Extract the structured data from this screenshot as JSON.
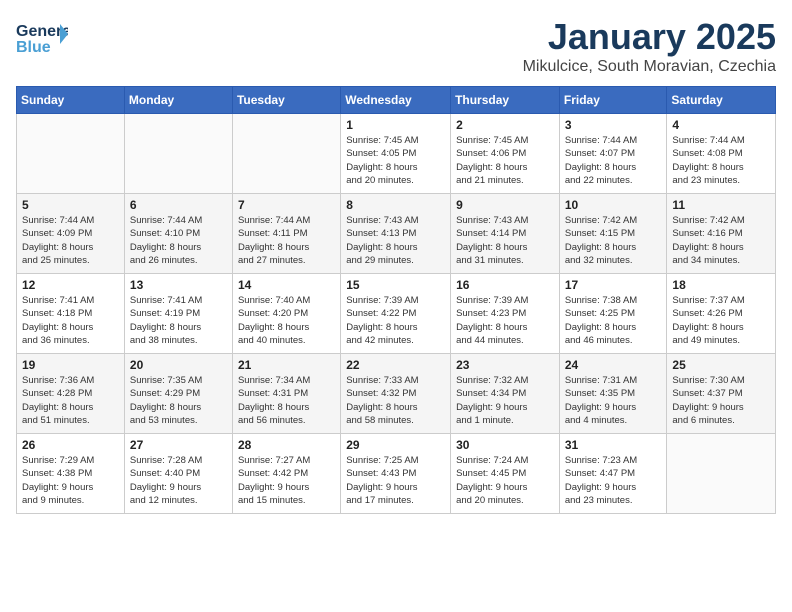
{
  "header": {
    "logo": {
      "line1": "General",
      "line2": "Blue"
    },
    "title": "January 2025",
    "location": "Mikulcice, South Moravian, Czechia"
  },
  "weekdays": [
    "Sunday",
    "Monday",
    "Tuesday",
    "Wednesday",
    "Thursday",
    "Friday",
    "Saturday"
  ],
  "weeks": [
    [
      {
        "day": "",
        "info": ""
      },
      {
        "day": "",
        "info": ""
      },
      {
        "day": "",
        "info": ""
      },
      {
        "day": "1",
        "info": "Sunrise: 7:45 AM\nSunset: 4:05 PM\nDaylight: 8 hours\nand 20 minutes."
      },
      {
        "day": "2",
        "info": "Sunrise: 7:45 AM\nSunset: 4:06 PM\nDaylight: 8 hours\nand 21 minutes."
      },
      {
        "day": "3",
        "info": "Sunrise: 7:44 AM\nSunset: 4:07 PM\nDaylight: 8 hours\nand 22 minutes."
      },
      {
        "day": "4",
        "info": "Sunrise: 7:44 AM\nSunset: 4:08 PM\nDaylight: 8 hours\nand 23 minutes."
      }
    ],
    [
      {
        "day": "5",
        "info": "Sunrise: 7:44 AM\nSunset: 4:09 PM\nDaylight: 8 hours\nand 25 minutes."
      },
      {
        "day": "6",
        "info": "Sunrise: 7:44 AM\nSunset: 4:10 PM\nDaylight: 8 hours\nand 26 minutes."
      },
      {
        "day": "7",
        "info": "Sunrise: 7:44 AM\nSunset: 4:11 PM\nDaylight: 8 hours\nand 27 minutes."
      },
      {
        "day": "8",
        "info": "Sunrise: 7:43 AM\nSunset: 4:13 PM\nDaylight: 8 hours\nand 29 minutes."
      },
      {
        "day": "9",
        "info": "Sunrise: 7:43 AM\nSunset: 4:14 PM\nDaylight: 8 hours\nand 31 minutes."
      },
      {
        "day": "10",
        "info": "Sunrise: 7:42 AM\nSunset: 4:15 PM\nDaylight: 8 hours\nand 32 minutes."
      },
      {
        "day": "11",
        "info": "Sunrise: 7:42 AM\nSunset: 4:16 PM\nDaylight: 8 hours\nand 34 minutes."
      }
    ],
    [
      {
        "day": "12",
        "info": "Sunrise: 7:41 AM\nSunset: 4:18 PM\nDaylight: 8 hours\nand 36 minutes."
      },
      {
        "day": "13",
        "info": "Sunrise: 7:41 AM\nSunset: 4:19 PM\nDaylight: 8 hours\nand 38 minutes."
      },
      {
        "day": "14",
        "info": "Sunrise: 7:40 AM\nSunset: 4:20 PM\nDaylight: 8 hours\nand 40 minutes."
      },
      {
        "day": "15",
        "info": "Sunrise: 7:39 AM\nSunset: 4:22 PM\nDaylight: 8 hours\nand 42 minutes."
      },
      {
        "day": "16",
        "info": "Sunrise: 7:39 AM\nSunset: 4:23 PM\nDaylight: 8 hours\nand 44 minutes."
      },
      {
        "day": "17",
        "info": "Sunrise: 7:38 AM\nSunset: 4:25 PM\nDaylight: 8 hours\nand 46 minutes."
      },
      {
        "day": "18",
        "info": "Sunrise: 7:37 AM\nSunset: 4:26 PM\nDaylight: 8 hours\nand 49 minutes."
      }
    ],
    [
      {
        "day": "19",
        "info": "Sunrise: 7:36 AM\nSunset: 4:28 PM\nDaylight: 8 hours\nand 51 minutes."
      },
      {
        "day": "20",
        "info": "Sunrise: 7:35 AM\nSunset: 4:29 PM\nDaylight: 8 hours\nand 53 minutes."
      },
      {
        "day": "21",
        "info": "Sunrise: 7:34 AM\nSunset: 4:31 PM\nDaylight: 8 hours\nand 56 minutes."
      },
      {
        "day": "22",
        "info": "Sunrise: 7:33 AM\nSunset: 4:32 PM\nDaylight: 8 hours\nand 58 minutes."
      },
      {
        "day": "23",
        "info": "Sunrise: 7:32 AM\nSunset: 4:34 PM\nDaylight: 9 hours\nand 1 minute."
      },
      {
        "day": "24",
        "info": "Sunrise: 7:31 AM\nSunset: 4:35 PM\nDaylight: 9 hours\nand 4 minutes."
      },
      {
        "day": "25",
        "info": "Sunrise: 7:30 AM\nSunset: 4:37 PM\nDaylight: 9 hours\nand 6 minutes."
      }
    ],
    [
      {
        "day": "26",
        "info": "Sunrise: 7:29 AM\nSunset: 4:38 PM\nDaylight: 9 hours\nand 9 minutes."
      },
      {
        "day": "27",
        "info": "Sunrise: 7:28 AM\nSunset: 4:40 PM\nDaylight: 9 hours\nand 12 minutes."
      },
      {
        "day": "28",
        "info": "Sunrise: 7:27 AM\nSunset: 4:42 PM\nDaylight: 9 hours\nand 15 minutes."
      },
      {
        "day": "29",
        "info": "Sunrise: 7:25 AM\nSunset: 4:43 PM\nDaylight: 9 hours\nand 17 minutes."
      },
      {
        "day": "30",
        "info": "Sunrise: 7:24 AM\nSunset: 4:45 PM\nDaylight: 9 hours\nand 20 minutes."
      },
      {
        "day": "31",
        "info": "Sunrise: 7:23 AM\nSunset: 4:47 PM\nDaylight: 9 hours\nand 23 minutes."
      },
      {
        "day": "",
        "info": ""
      }
    ]
  ]
}
